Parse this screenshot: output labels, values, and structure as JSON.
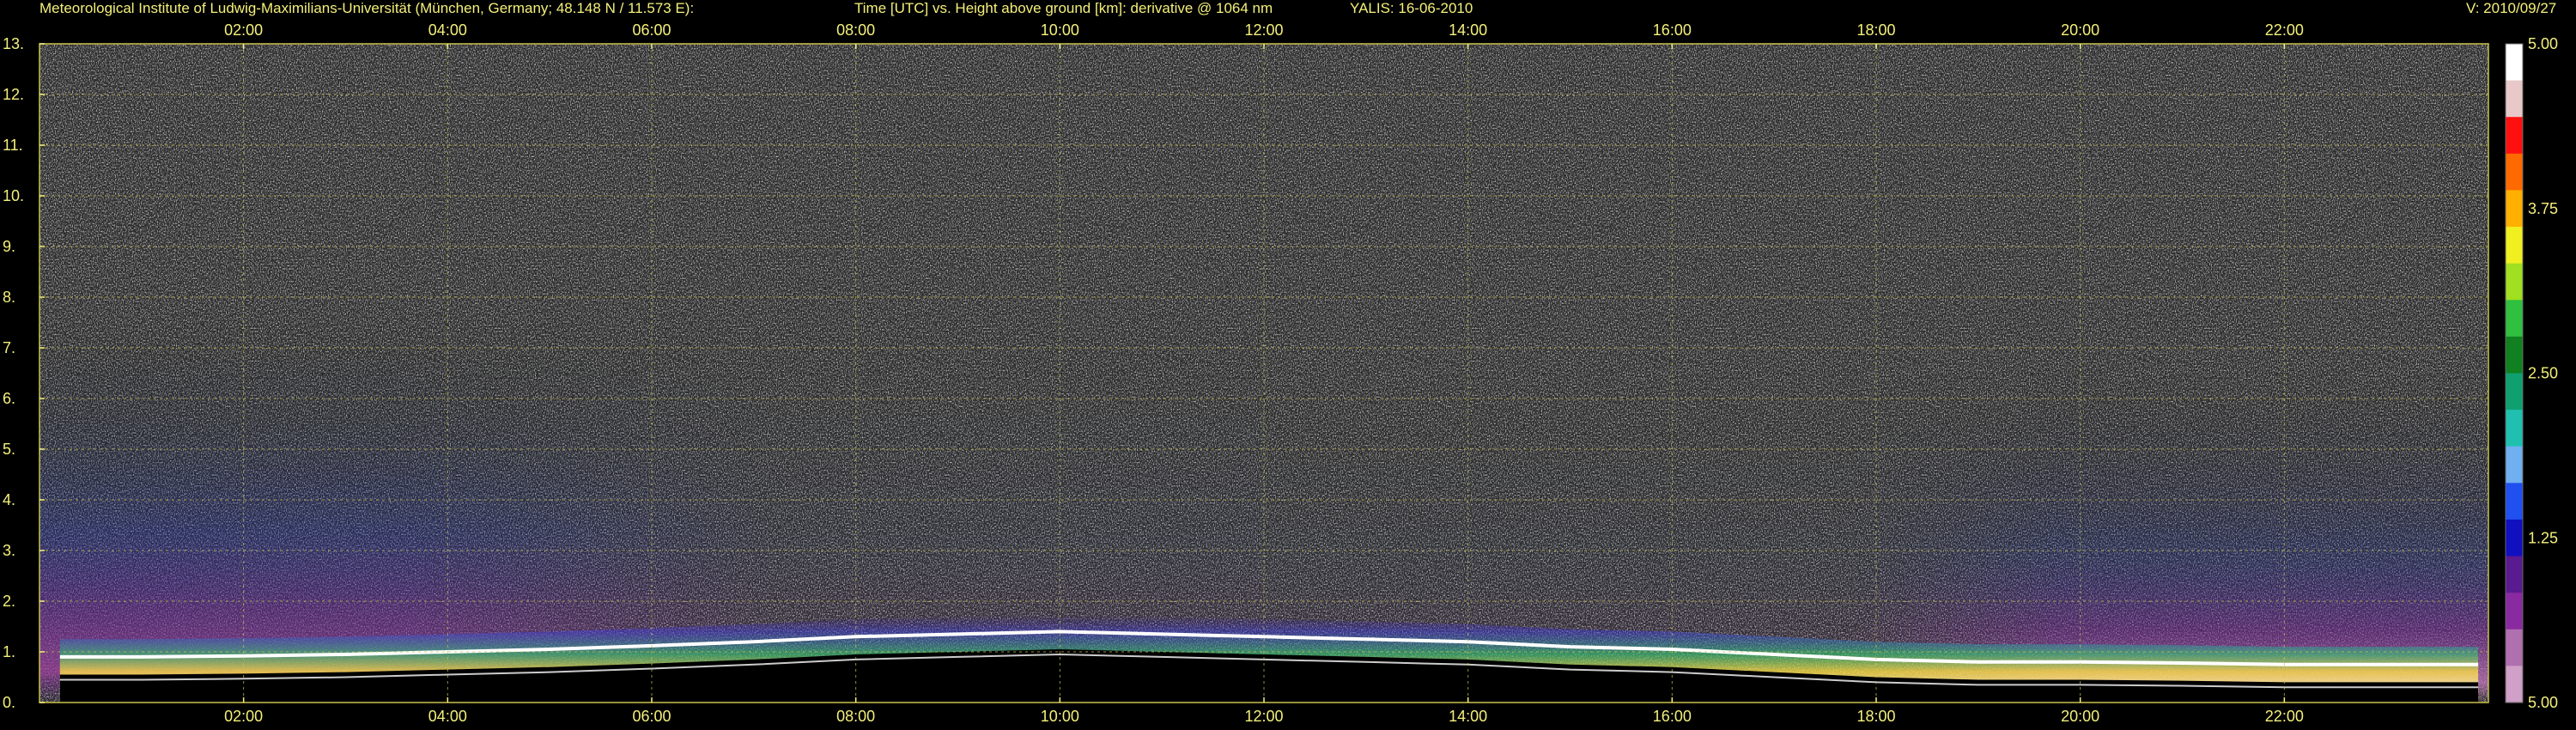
{
  "header": {
    "institute": "Meteorological Institute of Ludwig-Maximilians-Universität (München, Germany; 48.148 N / 11.573 E):",
    "description": "Time [UTC] vs. Height above ground [km]: derivative @ 1064 nm",
    "instrument": "YALIS: 16-06-2010",
    "version": "V: 2010/09/27"
  },
  "colors": {
    "label": "#f4f07a",
    "grid": "#c9c24a",
    "background": "#000000"
  },
  "chart_data": {
    "type": "heatmap",
    "title": "Time [UTC] vs. Height above ground [km]: derivative @ 1064 nm",
    "x_ticks": [
      "02:00",
      "04:00",
      "06:00",
      "08:00",
      "10:00",
      "12:00",
      "14:00",
      "16:00",
      "18:00",
      "20:00",
      "22:00"
    ],
    "x_tick_hours": [
      2,
      4,
      6,
      8,
      10,
      12,
      14,
      16,
      18,
      20,
      22
    ],
    "xlim_hours": [
      0,
      24
    ],
    "y_ticks": [
      "0.",
      "1.",
      "2.",
      "3.",
      "4.",
      "5.",
      "6.",
      "7.",
      "8.",
      "9.",
      "10.",
      "11.",
      "12.",
      "13."
    ],
    "ylim_km": [
      0,
      13
    ],
    "colorbar_ticks": [
      "5.00",
      "3.75",
      "2.50",
      "1.25",
      "5.00"
    ],
    "colorbar_tick_positions": [
      0,
      0.25,
      0.5,
      0.75,
      1
    ],
    "colorbar_colors": [
      "#ffffff",
      "#e8c8c8",
      "#ff1010",
      "#ff6a00",
      "#ffb000",
      "#f0f020",
      "#a0e020",
      "#30c040",
      "#108020",
      "#10a070",
      "#20c0b0",
      "#70b0f0",
      "#2050f0",
      "#1010c0",
      "#5a1a90",
      "#8a2aa0",
      "#b070b0",
      "#d0a0c8"
    ],
    "boundary_layer_top_km": [
      [
        0.2,
        0.9
      ],
      [
        1,
        0.9
      ],
      [
        2,
        0.92
      ],
      [
        3,
        0.95
      ],
      [
        4,
        1.0
      ],
      [
        5,
        1.05
      ],
      [
        6,
        1.12
      ],
      [
        7,
        1.2
      ],
      [
        8,
        1.3
      ],
      [
        9,
        1.35
      ],
      [
        10,
        1.4
      ],
      [
        11,
        1.35
      ],
      [
        12,
        1.3
      ],
      [
        13,
        1.25
      ],
      [
        14,
        1.2
      ],
      [
        15,
        1.1
      ],
      [
        16,
        1.05
      ],
      [
        17,
        0.95
      ],
      [
        18,
        0.85
      ],
      [
        19,
        0.8
      ],
      [
        20,
        0.8
      ],
      [
        21,
        0.78
      ],
      [
        22,
        0.75
      ],
      [
        23,
        0.75
      ],
      [
        23.9,
        0.75
      ]
    ],
    "residual_layer_top_km": [
      [
        0.2,
        3.0
      ],
      [
        2,
        3.2
      ],
      [
        4,
        2.0
      ],
      [
        6,
        1.3
      ],
      [
        18,
        2.2
      ],
      [
        20,
        2.6
      ],
      [
        22,
        2.7
      ],
      [
        23.9,
        2.7
      ]
    ],
    "grid": true,
    "colorbar": "right"
  }
}
